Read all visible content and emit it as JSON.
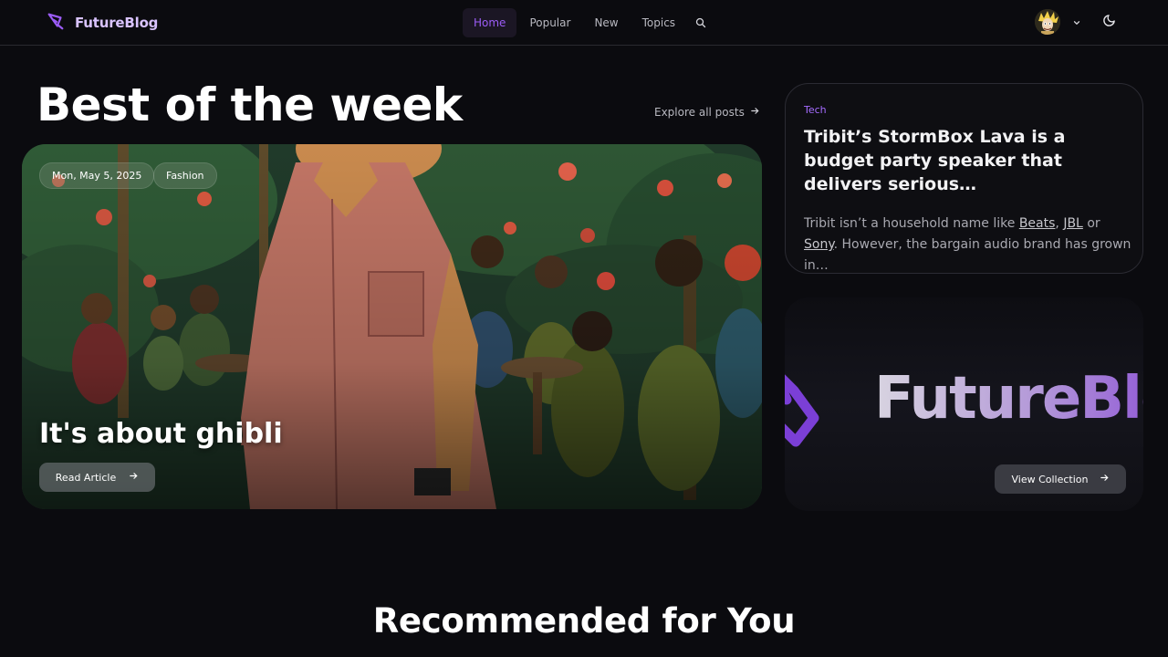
{
  "nav": {
    "brand": "FutureBlog",
    "links": [
      {
        "label": "Home",
        "active": true
      },
      {
        "label": "Popular",
        "active": false
      },
      {
        "label": "New",
        "active": false
      },
      {
        "label": "Topics",
        "active": false
      }
    ],
    "icons": {
      "logo": "pen-logo-icon",
      "search": "search-icon",
      "menu": "chevron-down-icon",
      "theme": "moon-icon"
    },
    "accent": "#9b5cf6"
  },
  "section": {
    "title": "Best of the week",
    "explore_label": "Explore all posts"
  },
  "hero": {
    "date": "Mon, May 5, 2025",
    "category": "Fashion",
    "title": "It's about ghibli",
    "cta": "Read Article"
  },
  "feature_card": {
    "tag": "Tech",
    "title": "Tribit’s StormBox Lava is a budget party speaker that delivers serious…",
    "desc_1": "Tribit isn’t a household name like ",
    "brand_1": "Beats",
    "sep_1": ", ",
    "brand_2": "JBL",
    "sep_2": " or ",
    "brand_3": "Sony",
    "desc_2": ". However, the bargain audio brand has grown in…"
  },
  "collection": {
    "word": "FutureBlo",
    "cta": "View Collection"
  },
  "recommended": {
    "title": "Recommended for You"
  }
}
